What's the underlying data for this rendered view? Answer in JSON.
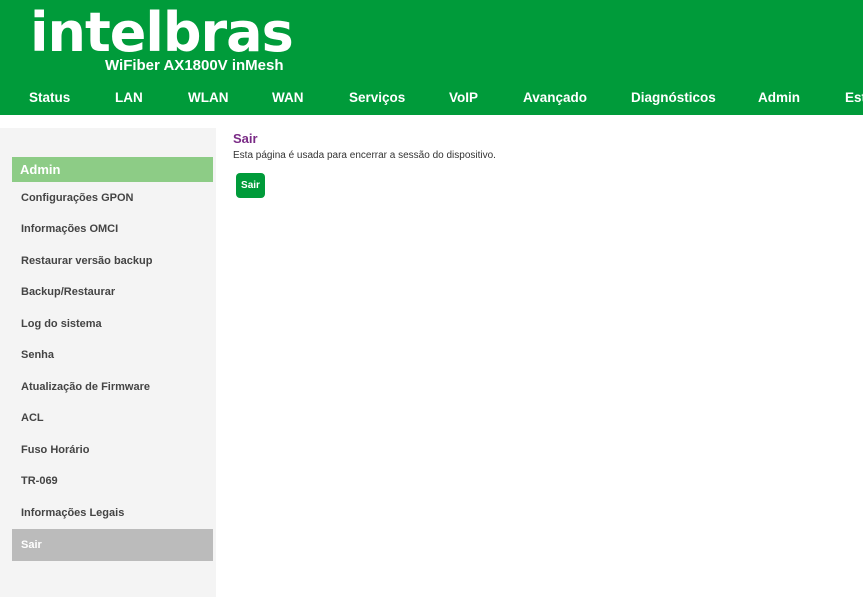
{
  "header": {
    "brand": "intelbras",
    "model": "WiFiber AX1800V inMesh"
  },
  "nav": [
    {
      "label": "Status"
    },
    {
      "label": "LAN"
    },
    {
      "label": "WLAN"
    },
    {
      "label": "WAN"
    },
    {
      "label": "Serviços"
    },
    {
      "label": "VoIP"
    },
    {
      "label": "Avançado"
    },
    {
      "label": "Diagnósticos"
    },
    {
      "label": "Admin"
    },
    {
      "label": "Estatísticas"
    }
  ],
  "sidebar": {
    "title": "Admin",
    "items": [
      {
        "label": "Configurações GPON"
      },
      {
        "label": "Informações OMCI"
      },
      {
        "label": "Restaurar versão backup"
      },
      {
        "label": "Backup/Restaurar"
      },
      {
        "label": "Log do sistema"
      },
      {
        "label": "Senha"
      },
      {
        "label": "Atualização de Firmware"
      },
      {
        "label": "ACL"
      },
      {
        "label": "Fuso Horário"
      },
      {
        "label": "TR-069"
      },
      {
        "label": "Informações Legais"
      },
      {
        "label": "Sair"
      }
    ]
  },
  "main": {
    "title": "Sair",
    "description": "Esta página é usada para encerrar a sessão do dispositivo.",
    "button_label": "Sair"
  },
  "colors": {
    "brand_green": "#009b3a",
    "sidebar_header": "#8dcc86",
    "title_purple": "#7a2b86",
    "active_item": "#bbbbbb"
  }
}
